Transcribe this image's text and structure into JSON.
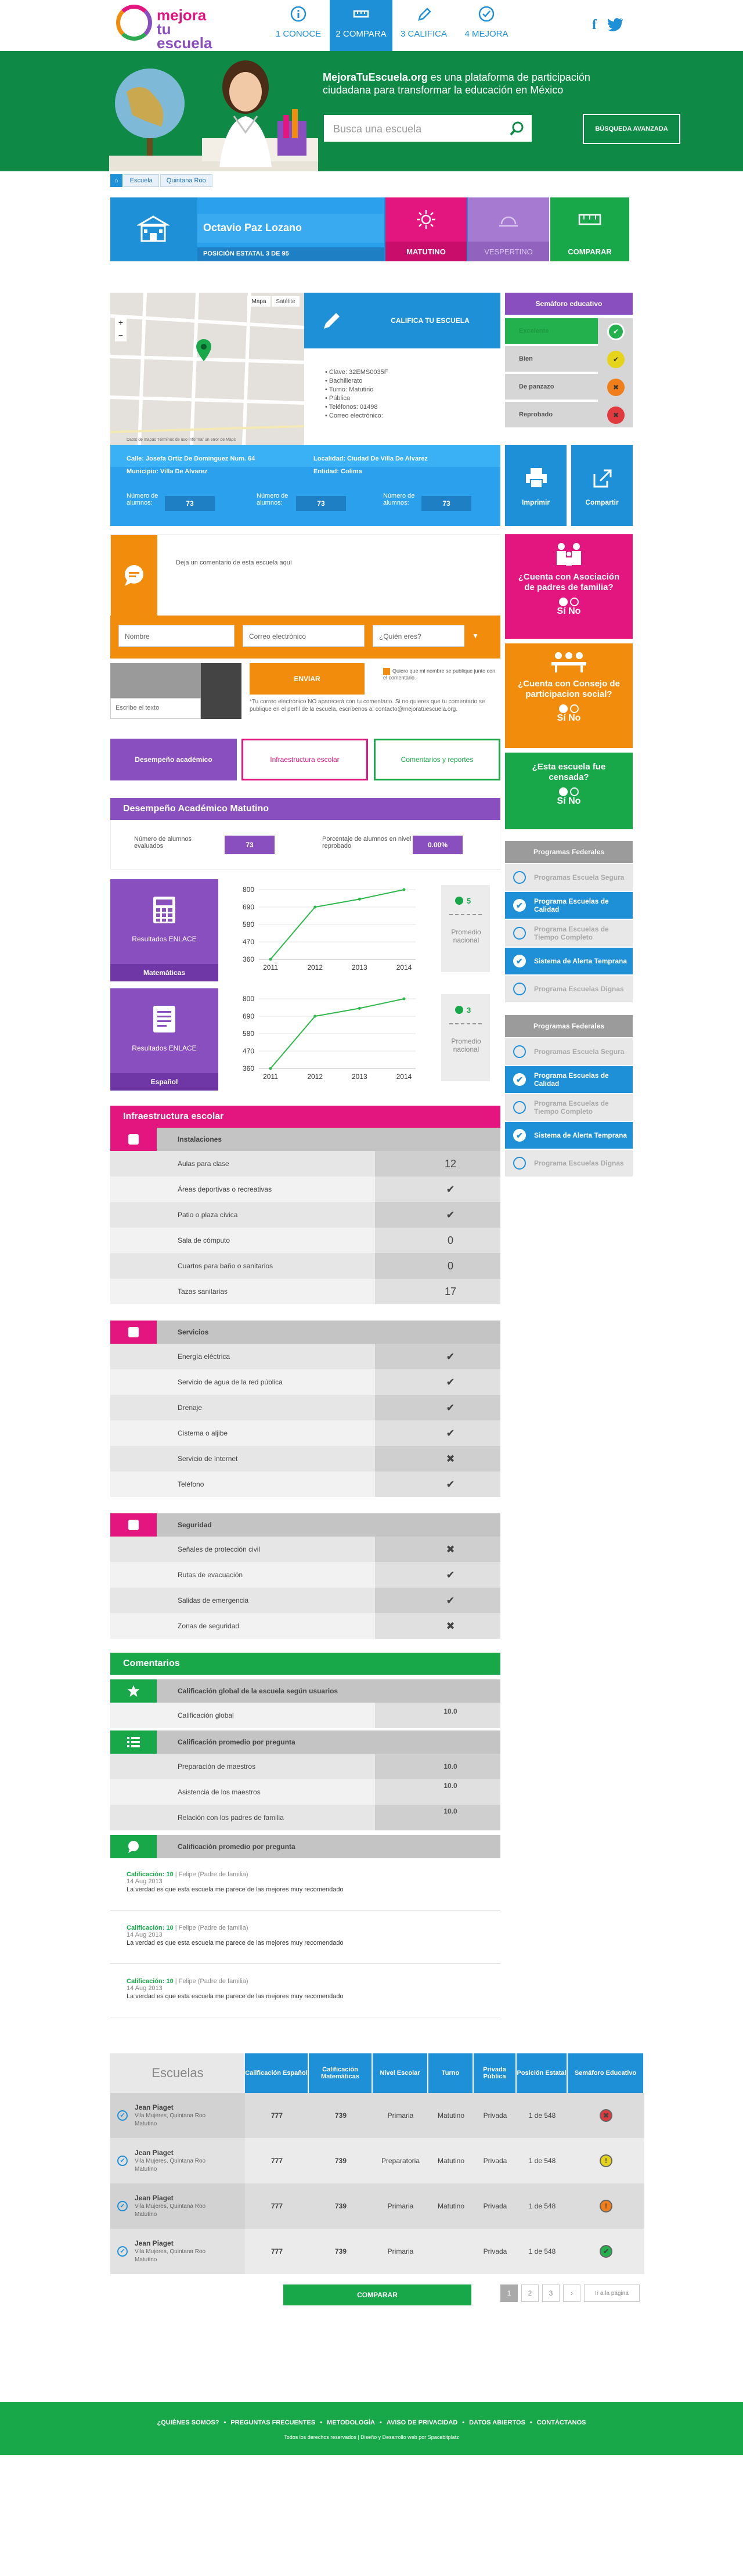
{
  "brand": {
    "line1": "mejora",
    "line2": "tu escuela"
  },
  "steps": [
    {
      "num": "1",
      "label": "CONOCE"
    },
    {
      "num": "2",
      "label": "COMPARA"
    },
    {
      "num": "3",
      "label": "CALIFICA"
    },
    {
      "num": "4",
      "label": "MEJORA"
    }
  ],
  "hero": {
    "brand": "MejoraTuEscuela.org",
    "text": " es una plataforma de participación ciudadana para transformar la educación en México",
    "search_placeholder": "Busca una escuela",
    "advanced": "BÚSQUEDA AVANZADA"
  },
  "breadcrumb": [
    "Escuela",
    "Quintana Roo"
  ],
  "school": {
    "name": "Octavio Paz Lozano",
    "rank": "POSICIÓN ESTATAL 3 DE 95",
    "shift1": "MATUTINO",
    "shift2": "VESPERTINO",
    "compare": "COMPARAR"
  },
  "map": {
    "mapa": "Mapa",
    "satelite": "Satélite",
    "footer": "Datos de mapas   Términos de uso   Informar un error de Maps"
  },
  "califica": "CALIFICA TU ESCUELA",
  "info": [
    "Clave: 32EMS0035F",
    "Bachillerato",
    "Turno: Matutino",
    "Pública",
    "Teléfonos: 01498",
    "Correo electrónico:"
  ],
  "semaforo": {
    "title": "Semáforo educativo",
    "levels": [
      "Excelente",
      "Bien",
      "De panzazo",
      "Reprobado"
    ],
    "colors": [
      "#22b14c",
      "#e6d41a",
      "#f07f1b",
      "#e0393e"
    ]
  },
  "address": {
    "calle": "Calle: Josefa Ortiz De Dominguez Num. 64",
    "localidad": "Localidad: Ciudad De Villa De Alvarez",
    "municipio": "Municipio: Villa De Alvarez",
    "entidad": "Entidad: Colima",
    "alumnos_label": "Número de alumnos:",
    "alumnos": [
      "73",
      "73",
      "73"
    ],
    "imprimir": "Imprimir",
    "compartir": "Compartir"
  },
  "comment": {
    "placeholder": "Deja un comentario de esta escuela aquí",
    "nombre": "Nombre",
    "correo": "Correo electrónico",
    "quien": "¿Quién eres?",
    "captcha": "Escribe el texto",
    "enviar": "ENVIAR",
    "check": "Quiero que mi nombre se publique junto con el comentario.",
    "note": "*Tu correo electrónico NO aparecerá con tu comentario. Si no quieres que tu comentario se publique en el perfil de la escuela, escríbenos a: contacto@mejoratuescuela.org."
  },
  "questions": [
    {
      "q": "¿Cuenta con Asociación de padres de familia?",
      "yes": "Sí",
      "no": "No",
      "color": "#e3157e"
    },
    {
      "q": "¿Cuenta con Consejo de participacion social?",
      "yes": "Sí",
      "no": "No",
      "color": "#f28c0c"
    },
    {
      "q": "¿Esta escuela fue censada?",
      "yes": "Sí",
      "no": "No",
      "color": "#18a84a"
    }
  ],
  "tabs": [
    "Desempeño académico",
    "Infraestructura escolar",
    "Comentarios y reportes"
  ],
  "desempeno": {
    "title": "Desempeño Académico Matutino",
    "evaluados": "Número de alumnos evaluados",
    "evaluados_val": "73",
    "reprobado": "Porcentaje de alumnos en nivel reprobado",
    "reprobado_val": "0.00%",
    "results": "Resultados ENLACE",
    "materias": [
      "Matemáticas",
      "Español"
    ],
    "nacional": "Promedio nacional",
    "ranks": [
      "5",
      "3"
    ]
  },
  "chart_data": [
    {
      "type": "line",
      "x": [
        "2011",
        "2012",
        "2013",
        "2014"
      ],
      "yticks": [
        360,
        470,
        580,
        690,
        800
      ],
      "ylim": [
        360,
        800
      ],
      "series": [
        {
          "values": [
            360,
            690,
            740,
            800
          ]
        }
      ]
    },
    {
      "type": "line",
      "x": [
        "2011",
        "2012",
        "2013",
        "2014"
      ],
      "yticks": [
        360,
        470,
        580,
        690,
        800
      ],
      "ylim": [
        360,
        800
      ],
      "series": [
        {
          "values": [
            360,
            690,
            740,
            800
          ]
        }
      ]
    }
  ],
  "programas": [
    {
      "title": "Programas Federales",
      "items": [
        {
          "label": "Programas Escuela Segura",
          "on": false
        },
        {
          "label": "Programa Escuelas de Calidad",
          "on": true
        },
        {
          "label": "Programa Escuelas de Tiempo Completo",
          "on": false
        },
        {
          "label": "Sistema de Alerta Temprana",
          "on": true
        },
        {
          "label": "Programa Escuelas Dignas",
          "on": false
        }
      ]
    },
    {
      "title": "Programas Federales",
      "items": [
        {
          "label": "Programas Escuela Segura",
          "on": false
        },
        {
          "label": "Programa Escuelas de Calidad",
          "on": true
        },
        {
          "label": "Programa Escuelas de Tiempo Completo",
          "on": false
        },
        {
          "label": "Sistema de Alerta Temprana",
          "on": true
        },
        {
          "label": "Programa Escuelas Dignas",
          "on": false
        }
      ]
    }
  ],
  "infra": {
    "title": "Infraestructura escolar",
    "sections": [
      {
        "title": "Instalaciones",
        "color": "#e3157e",
        "rows": [
          {
            "n": "Aulas para clase",
            "v": "12"
          },
          {
            "n": "Áreas deportivas o recreativas",
            "v": "✔"
          },
          {
            "n": "Patio o plaza cívica",
            "v": "✔"
          },
          {
            "n": "Sala de cómputo",
            "v": "0"
          },
          {
            "n": "Cuartos para baño o sanitarios",
            "v": "0"
          },
          {
            "n": "Tazas sanitarias",
            "v": "17"
          }
        ]
      },
      {
        "title": "Servicios",
        "color": "#e3157e",
        "rows": [
          {
            "n": "Energía eléctrica",
            "v": "✔"
          },
          {
            "n": "Servicio de agua de la red pública",
            "v": "✔"
          },
          {
            "n": "Drenaje",
            "v": "✔"
          },
          {
            "n": "Cisterna o aljibe",
            "v": "✔"
          },
          {
            "n": "Servicio de Internet",
            "v": "✖"
          },
          {
            "n": "Teléfono",
            "v": "✔"
          }
        ]
      },
      {
        "title": "Seguridad",
        "color": "#e3157e",
        "rows": [
          {
            "n": "Señales de protección civil",
            "v": "✖"
          },
          {
            "n": "Rutas de evacuación",
            "v": "✔"
          },
          {
            "n": "Salidas de emergencia",
            "v": "✔"
          },
          {
            "n": "Zonas de seguridad",
            "v": "✖"
          }
        ]
      }
    ]
  },
  "comentarios": {
    "title": "Comentarios",
    "global_title": "Calificación global de la escuela según usuarios",
    "global_label": "Calificación global",
    "global_val": "10.0",
    "prom_title": "Calificación promedio por pregunta",
    "preguntas": [
      {
        "n": "Preparación de maestros",
        "v": "10.0"
      },
      {
        "n": "Asistencia de los maestros",
        "v": "10.0"
      },
      {
        "n": "Relación con los padres de familia",
        "v": "10.0"
      }
    ],
    "list_title": "Calificación promedio por pregunta",
    "items": [
      {
        "score": "Calificación: 10",
        "who": " | Felipe (Padre de familia)",
        "date": "14 Aug 2013",
        "text": "La verdad es que esta escuela me parece de las mejores muy recomendado"
      },
      {
        "score": "Calificación: 10",
        "who": " | Felipe (Padre de familia)",
        "date": "14 Aug 2013",
        "text": "La verdad es que esta escuela me parece de las mejores muy recomendado"
      },
      {
        "score": "Calificación: 10",
        "who": " | Felipe (Padre de familia)",
        "date": "14 Aug 2013",
        "text": "La verdad es que esta escuela me parece de las mejores muy recomendado"
      }
    ]
  },
  "compare_table": {
    "headers": [
      "Escuelas",
      "Calificación Español",
      "Calificación Matemáticas",
      "Nivel Escolar",
      "Turno",
      "Privada Pública",
      "Posición Estatal",
      "Semáforo Educativo"
    ],
    "rows": [
      {
        "name": "Jean Piaget",
        "loc": "Vila Mujeres, Quintana Roo",
        "turno_s": "Matutino",
        "esp": "777",
        "mat": "739",
        "nivel": "Primaria",
        "turno": "Matutino",
        "tipo": "Privada",
        "pos": "1 de 548",
        "sem": "✖",
        "semc": "#e0393e"
      },
      {
        "name": "Jean Piaget",
        "loc": "Vila Mujeres, Quintana Roo",
        "turno_s": "Matutino",
        "esp": "777",
        "mat": "739",
        "nivel": "Preparatoria",
        "turno": "Matutino",
        "tipo": "Privada",
        "pos": "1 de 548",
        "sem": "!",
        "semc": "#e6d41a"
      },
      {
        "name": "Jean Piaget",
        "loc": "Vila Mujeres, Quintana Roo",
        "turno_s": "Matutino",
        "esp": "777",
        "mat": "739",
        "nivel": "Primaria",
        "turno": "Matutino",
        "tipo": "Privada",
        "pos": "1 de 548",
        "sem": "!",
        "semc": "#f07f1b"
      },
      {
        "name": "Jean Piaget",
        "loc": "Vila Mujeres, Quintana Roo",
        "turno_s": "Matutino",
        "esp": "777",
        "mat": "739",
        "nivel": "Primaria",
        "turno": "",
        "tipo": "Privada",
        "pos": "1 de 548",
        "sem": "✔",
        "semc": "#22b14c"
      }
    ],
    "compare_btn": "COMPARAR",
    "pages": [
      "1",
      "2",
      "3"
    ],
    "next": "Ir a la página"
  },
  "footer": {
    "links": [
      "¿QUIÉNES SOMOS?",
      "PREGUNTAS FRECUENTES",
      "METODOLOGÍA",
      "AVISO DE PRIVACIDAD",
      "DATOS ABIERTOS",
      "CONTÁCTANOS"
    ],
    "legal": "Todos los derechos reservados   |   Diseño y Desarrollo web por Spacebitplatz"
  }
}
